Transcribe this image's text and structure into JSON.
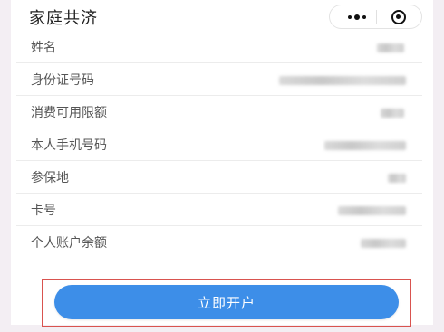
{
  "header": {
    "title": "家庭共济"
  },
  "form": {
    "rows": [
      {
        "label": "姓名"
      },
      {
        "label": "身份证号码"
      },
      {
        "label": "消费可用限额"
      },
      {
        "label": "本人手机号码"
      },
      {
        "label": "参保地"
      },
      {
        "label": "卡号"
      },
      {
        "label": "个人账户余额"
      }
    ]
  },
  "action": {
    "open_account_label": "立即开户"
  },
  "colors": {
    "primary": "#3d8ee8",
    "highlight_border": "#d9534f"
  }
}
